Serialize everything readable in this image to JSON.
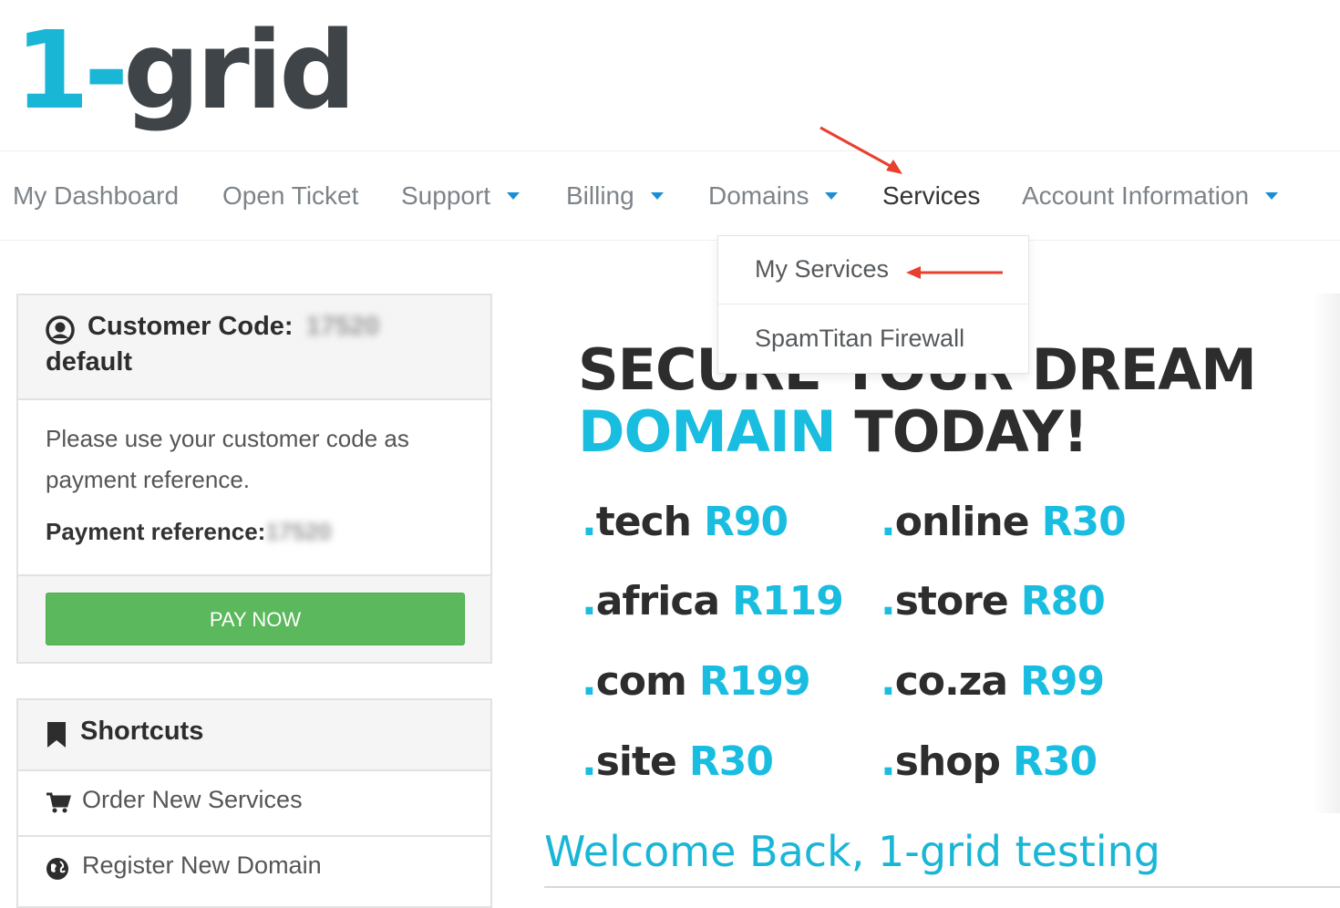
{
  "brand": {
    "logo_one": "1-",
    "logo_rest": "grid"
  },
  "nav": {
    "items": [
      {
        "label": "My Dashboard",
        "caret": false
      },
      {
        "label": "Open Ticket",
        "caret": false
      },
      {
        "label": "Support",
        "caret": true
      },
      {
        "label": "Billing",
        "caret": true
      },
      {
        "label": "Domains",
        "caret": true
      },
      {
        "label": "Services",
        "caret": false,
        "active": true
      },
      {
        "label": "Account Information",
        "caret": true
      }
    ],
    "dropdown": [
      "My Services",
      "SpamTitan Firewall"
    ]
  },
  "customer_panel": {
    "title": "Customer Code:",
    "code_masked": "17520",
    "subtitle": "default",
    "message": "Please use your customer code as payment reference.",
    "payment_label": "Payment reference:",
    "payment_masked": "17520",
    "button": "PAY NOW"
  },
  "shortcuts": {
    "title": "Shortcuts",
    "items": [
      {
        "label": "Order New Services",
        "icon": "cart-icon"
      },
      {
        "label": "Register New Domain",
        "icon": "globe-icon"
      }
    ]
  },
  "banner": {
    "line1": "SECURE YOUR DREAM",
    "line2_blue": "DOMAIN",
    "line2_dark": "TODAY!",
    "prices": [
      {
        "tld": "tech",
        "price": "R90"
      },
      {
        "tld": "online",
        "price": "R30"
      },
      {
        "tld": "africa",
        "price": "R119"
      },
      {
        "tld": "store",
        "price": "R80"
      },
      {
        "tld": "com",
        "price": "R199"
      },
      {
        "tld": "co.za",
        "price": "R99"
      },
      {
        "tld": "site",
        "price": "R30"
      },
      {
        "tld": "shop",
        "price": "R30"
      }
    ]
  },
  "welcome": "Welcome Back, 1-grid testing",
  "colors": {
    "brand_blue": "#1ab6d6",
    "brand_dark": "#3f4448",
    "pay_green": "#5cb85c",
    "annotation_red": "#e8402f"
  }
}
